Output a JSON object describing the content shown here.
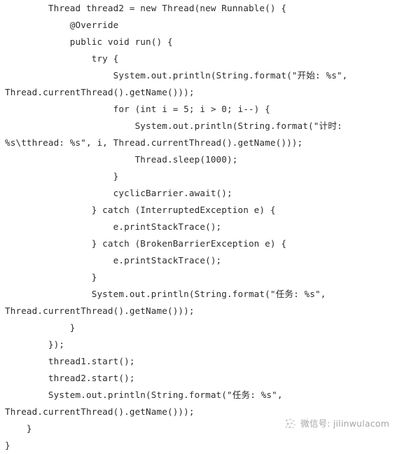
{
  "document": {
    "language": "java",
    "background_color": "#ffffff",
    "text_color": "#2b2b2b",
    "lines": [
      "        Thread thread2 = new Thread(new Runnable() {",
      "            @Override",
      "            public void run() {",
      "                try {",
      "                    System.out.println(String.format(\"开始: %s\",",
      "Thread.currentThread().getName()));",
      "                    for (int i = 5; i > 0; i--) {",
      "                        System.out.println(String.format(\"计时:",
      "%s\\tthread: %s\", i, Thread.currentThread().getName()));",
      "                        Thread.sleep(1000);",
      "                    }",
      "                    cyclicBarrier.await();",
      "                } catch (InterruptedException e) {",
      "                    e.printStackTrace();",
      "                } catch (BrokenBarrierException e) {",
      "                    e.printStackTrace();",
      "                }",
      "                System.out.println(String.format(\"任务: %s\",",
      "Thread.currentThread().getName()));",
      "            }",
      "        });",
      "        thread1.start();",
      "        thread2.start();",
      "        System.out.println(String.format(\"任务: %s\",",
      "Thread.currentThread().getName()));",
      "    }",
      "}"
    ]
  },
  "watermark": {
    "logo_icon": "wechat-scatter-dots-logo",
    "text": "微信号: jilinwulacom",
    "color": "#6e6e6e"
  }
}
